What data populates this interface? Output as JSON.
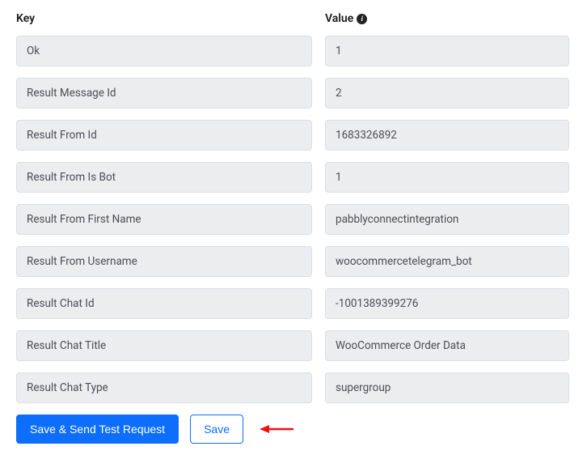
{
  "headers": {
    "key": "Key",
    "value": "Value"
  },
  "rows": [
    {
      "key": "Ok",
      "value": "1"
    },
    {
      "key": "Result Message Id",
      "value": "2"
    },
    {
      "key": "Result From Id",
      "value": "1683326892"
    },
    {
      "key": "Result From Is Bot",
      "value": "1"
    },
    {
      "key": "Result From First Name",
      "value": "pabblyconnectintegration"
    },
    {
      "key": "Result From Username",
      "value": "woocommercetelegram_bot"
    },
    {
      "key": "Result Chat Id",
      "value": "-1001389399276"
    },
    {
      "key": "Result Chat Title",
      "value": "WooCommerce Order Data"
    },
    {
      "key": "Result Chat Type",
      "value": "supergroup"
    }
  ],
  "buttons": {
    "save_send": "Save & Send Test Request",
    "save": "Save"
  }
}
